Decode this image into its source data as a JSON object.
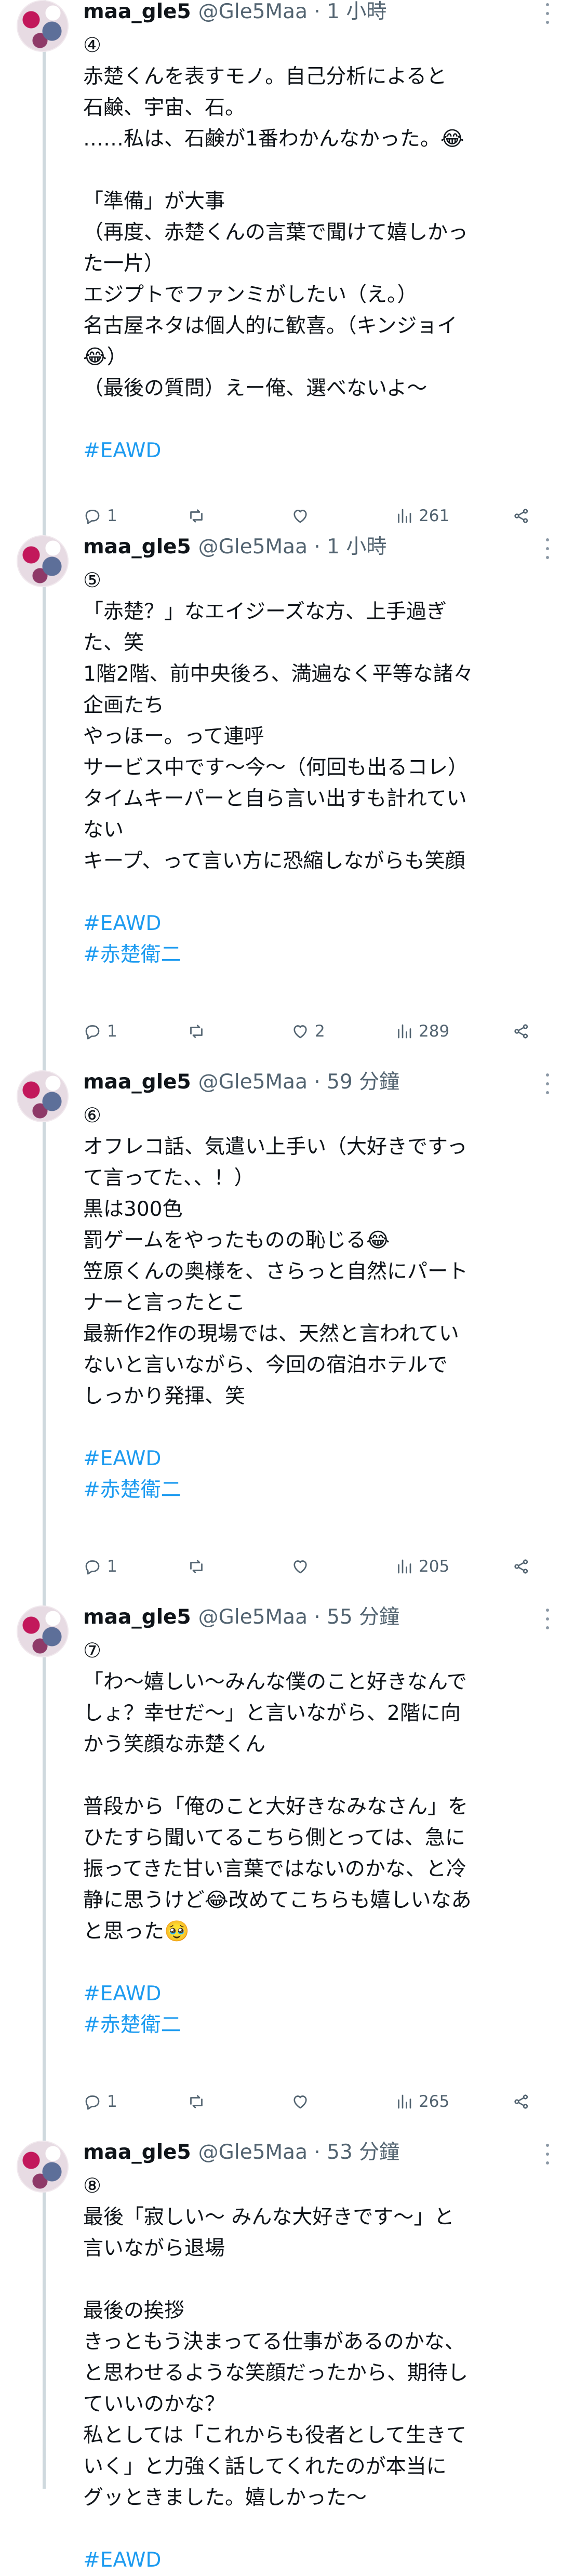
{
  "tweets": [
    {
      "name": "maa_gle5",
      "handle": "@Gle5Maa · 1 小時",
      "lines": [
        "④",
        "赤楚くんを表すモノ。自己分析によると",
        "石鹸、宇宙、石。",
        "……私は、石鹸が1番わかんなかった。😂",
        "",
        "「準備」が大事",
        "（再度、赤楚くんの言葉で聞けて嬉しかっ",
        "た一片）",
        "エジプトでファンミがしたい（え。）",
        "名古屋ネタは個人的に歓喜。（キンジョイ",
        "😂）",
        "（最後の質問）えー俺、選べないよ〜",
        ""
      ],
      "hashtags": [
        "#EAWD"
      ],
      "replies": "1",
      "retweets": "",
      "likes": "",
      "views": "261"
    },
    {
      "name": "maa_gle5",
      "handle": "@Gle5Maa · 1 小時",
      "lines": [
        "⑤",
        "「赤楚？」なエイジーズな方、上手過ぎ",
        "た、笑",
        "1階2階、前中央後ろ、満遍なく平等な諸々",
        "企画たち",
        "やっほー。って連呼",
        "サービス中です〜今〜（何回も出るコレ）",
        "タイムキーパーと自ら言い出すも計れてい",
        "ない",
        "キープ、って言い方に恐縮しながらも笑顔",
        ""
      ],
      "hashtags": [
        "#EAWD",
        "#赤楚衛二"
      ],
      "replies": "1",
      "retweets": "",
      "likes": "2",
      "views": "289"
    },
    {
      "name": "maa_gle5",
      "handle": "@Gle5Maa · 59 分鐘",
      "lines": [
        "⑥",
        "オフレコ話、気遣い上手い（大好きですっ",
        "て言ってた、、！）",
        "黒は300色",
        "罰ゲームをやったものの恥じる😂",
        "笠原くんの奥様を、さらっと自然にパート",
        "ナーと言ったとこ",
        "最新作2作の現場では、天然と言われてい",
        "ないと言いながら、今回の宿泊ホテルで",
        "しっかり発揮、笑",
        ""
      ],
      "hashtags": [
        "#EAWD",
        "#赤楚衛二"
      ],
      "replies": "1",
      "retweets": "",
      "likes": "",
      "views": "205"
    },
    {
      "name": "maa_gle5",
      "handle": "@Gle5Maa · 55 分鐘",
      "lines": [
        "⑦",
        "「わ〜嬉しい〜みんな僕のこと好きなんで",
        "しょ？幸せだ〜」と言いながら、2階に向",
        "かう笑顔な赤楚くん",
        "",
        "普段から「俺のこと大好きなみなさん」を",
        "ひたすら聞いてるこちら側とっては、急に",
        "振ってきた甘い言葉ではないのかな、と冷",
        "静に思うけど😂改めてこちらも嬉しいなあ",
        "と思った🥹",
        ""
      ],
      "hashtags": [
        "#EAWD",
        "#赤楚衛二"
      ],
      "replies": "1",
      "retweets": "",
      "likes": "",
      "views": "265"
    },
    {
      "name": "maa_gle5",
      "handle": "@Gle5Maa · 53 分鐘",
      "lines": [
        "⑧",
        "最後「寂しい〜 みんな大好きです〜」と",
        "言いながら退場",
        "",
        "最後の挨拶",
        "きっともう決まってる仕事があるのかな、",
        "と思わせるような笑顔だったから、期待し",
        "ていいのかな？",
        "私としては「これからも役者として生きて",
        "いく」と力強く話してくれたのが本当に",
        "グッときました。嬉しかった〜",
        ""
      ],
      "hashtags": [
        "#EAWD"
      ],
      "replies": "",
      "retweets": "",
      "likes": "",
      "views": ""
    }
  ]
}
